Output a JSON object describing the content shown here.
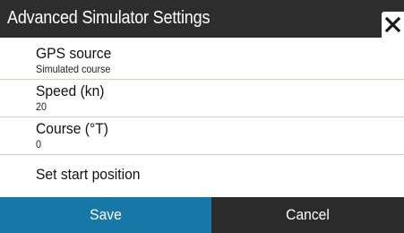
{
  "dialog": {
    "title": "Advanced Simulator Settings",
    "close_icon": "close-icon",
    "items": [
      {
        "label": "GPS source",
        "value": "Simulated course"
      },
      {
        "label": "Speed (kn)",
        "value": "20"
      },
      {
        "label": "Course (°T)",
        "value": "0"
      },
      {
        "label": "Set start position"
      }
    ],
    "buttons": {
      "save_label": "Save",
      "cancel_label": "Cancel"
    }
  },
  "colors": {
    "titlebar": "#2d2d2d",
    "save_button": "#1777a6",
    "cancel_button": "#2b2b2b",
    "divider": "#e9c8c8"
  }
}
